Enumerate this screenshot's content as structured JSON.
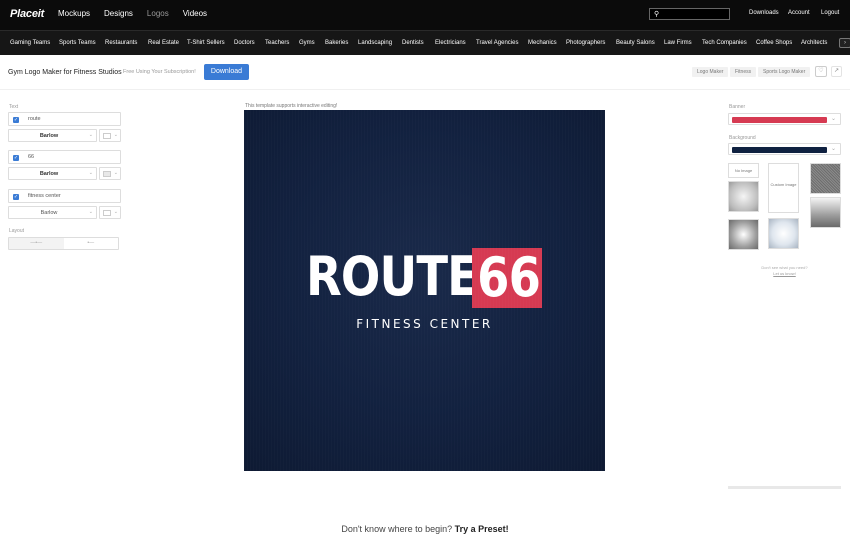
{
  "topnav": {
    "logo": "Placeit",
    "items": [
      "Mockups",
      "Designs",
      "Logos",
      "Videos"
    ],
    "search": {
      "placeholder": ""
    },
    "downloads": "Downloads",
    "account": "Account",
    "logout": "Logout"
  },
  "categories": [
    "Gaming Teams",
    "Sports Teams",
    "Restaurants",
    "Real Estate",
    "T-Shirt Sellers",
    "Doctors",
    "Teachers",
    "Gyms",
    "Bakeries",
    "Landscaping",
    "Dentists",
    "Electricians",
    "Travel Agencies",
    "Mechanics",
    "Photographers",
    "Beauty Salons",
    "Law Firms",
    "Tech Companies",
    "Coffee Shops",
    "Architects"
  ],
  "titlebar": {
    "title": "Gym Logo Maker for Fitness Studios",
    "subscription": "Free Using Your Subscription!",
    "download": "Download",
    "tags": [
      "Logo Maker",
      "Fitness",
      "Sports Logo Maker"
    ]
  },
  "left_panel": {
    "text_label": "Text",
    "fields": [
      {
        "value": "route",
        "font": "Barlow"
      },
      {
        "value": "66",
        "font": "Barlow"
      },
      {
        "value": "fitness center",
        "font": "Barlow"
      }
    ],
    "layout_label": "Layout"
  },
  "canvas": {
    "note": "This template supports interactive editing!",
    "word": "ROUTE",
    "badge": "66",
    "sub": "FITNESS CENTER",
    "colors": {
      "background": "#12213f",
      "banner": "#d63a52"
    }
  },
  "right_panel": {
    "banner_label": "Banner",
    "banner_color": "#d63a52",
    "background_label": "Background",
    "background_color": "#0f2140",
    "no_image": "No Image",
    "custom_image": "Custom Image",
    "help": "Don't see what you need?",
    "help_link": "Let us know!"
  },
  "footer": {
    "preset_prefix": "Don't know where to begin?",
    "preset_link": "Try a Preset!"
  }
}
